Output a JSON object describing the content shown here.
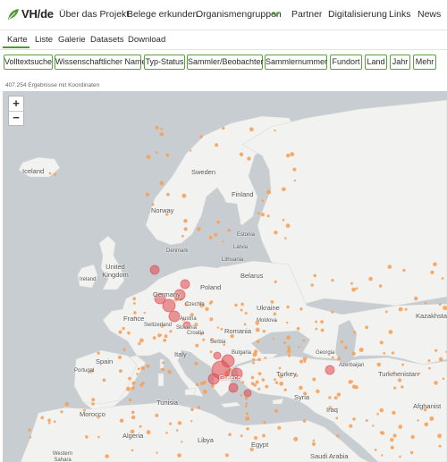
{
  "brand": {
    "name": "VH/de",
    "icon": "leaf-logo-icon",
    "accent": "#4a9a2e"
  },
  "nav": {
    "items": [
      "Über das Projekt",
      "Belege erkunden",
      "Organismengruppen",
      "Partner",
      "Digitalisierung",
      "Links",
      "News"
    ],
    "dropdown_icon": "chevron-down-icon"
  },
  "tabs": {
    "items": [
      "Karte",
      "Liste",
      "Galerie",
      "Datasets",
      "Download"
    ],
    "active": "Karte"
  },
  "filters": [
    "Volltextsuche",
    "Wissenschaftlicher Name",
    "Typ-Status",
    "Sammler/Beobachter",
    "Sammlernummer",
    "Fundort",
    "Land",
    "Jahr",
    "Mehr"
  ],
  "results": {
    "text": "407.254 Ergebnisse mit Koordinaten"
  },
  "map": {
    "zoom_in": "+",
    "zoom_out": "−",
    "labels": [
      "Iceland",
      "Sweden",
      "Finland",
      "Norway",
      "Estonia",
      "Latvia",
      "Lithuania",
      "Denmark",
      "United Kingdom",
      "Ireland",
      "Belarus",
      "Poland",
      "Germany",
      "Czechia",
      "Ukraine",
      "Moldova",
      "France",
      "Austria",
      "Switzerland",
      "Slovenia",
      "Croatia",
      "Romania",
      "Serbia",
      "Bulgaria",
      "Italy",
      "Spain",
      "Portugal",
      "Greece",
      "Turkey",
      "Georgia",
      "Azerbaijan",
      "Kazakhsta",
      "Turkmenistan",
      "Syria",
      "Iraq",
      "Tunisia",
      "Morocco",
      "Algeria",
      "Libya",
      "Egypt",
      "Saudi Arabia",
      "Afghanist",
      "Western Sahara"
    ],
    "marker_colors": {
      "occurrence": "#f5a25a",
      "cluster": "#e0474c"
    },
    "land_color": "#f2f2f0",
    "water_color": "#c8cdd1"
  }
}
